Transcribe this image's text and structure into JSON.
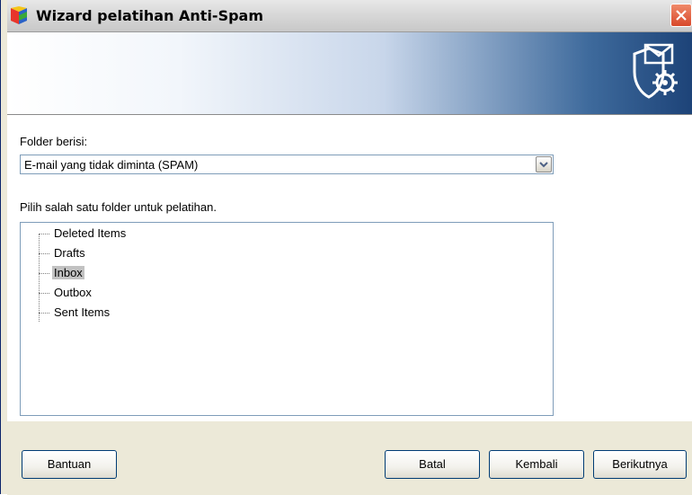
{
  "window": {
    "title": "Wizard pelatihan Anti-Spam"
  },
  "icons": {
    "app": "avg-logo-icon",
    "close": "close-icon",
    "banner": "shield-mail-gear-icon",
    "dropdown": "chevron-down-icon"
  },
  "form": {
    "folder_label": "Folder berisi:",
    "folder_value": "E-mail yang tidak diminta (SPAM)",
    "instruction": "Pilih salah satu folder untuk pelatihan."
  },
  "tree": {
    "items": [
      {
        "label": "Deleted Items",
        "selected": false
      },
      {
        "label": "Drafts",
        "selected": false
      },
      {
        "label": "Inbox",
        "selected": true
      },
      {
        "label": "Outbox",
        "selected": false
      },
      {
        "label": "Sent Items",
        "selected": false
      }
    ]
  },
  "buttons": {
    "help": "Bantuan",
    "cancel": "Batal",
    "back": "Kembali",
    "next": "Berikutnya"
  },
  "colors": {
    "selection": "#c2c2c2",
    "close_button": "#d8482a",
    "banner_dark": "#1d4378"
  }
}
